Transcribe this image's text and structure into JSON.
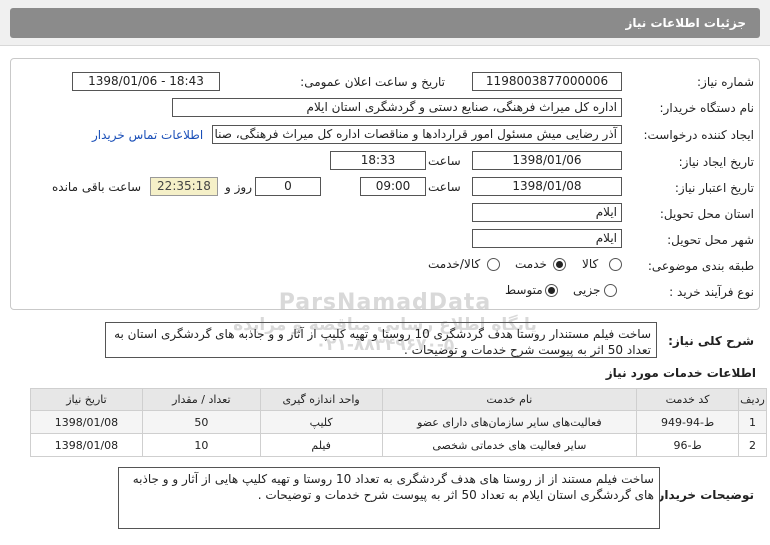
{
  "header": {
    "title": "جزئیات اطلاعات نیاز"
  },
  "form": {
    "need_number": {
      "label": "شماره نیاز:",
      "value": "1198003877000006"
    },
    "announce": {
      "label": "تاریخ و ساعت اعلان عمومی:",
      "value": "1398/01/06 - 18:43"
    },
    "buyer": {
      "label": "نام دستگاه خریدار:",
      "value": "اداره کل میراث فرهنگی، صنایع دستی و گردشگری استان ایلام"
    },
    "requester": {
      "label": "ایجاد کننده درخواست:",
      "value": "آذر رضایی میش مسئول امور قراردادها و مناقصات اداره کل میراث فرهنگی، صنا",
      "contact_link": "اطلاعات تماس خریدار"
    },
    "created": {
      "label": "تاریخ ایجاد نیاز:",
      "date": "1398/01/06",
      "time_label": "ساعت",
      "time": "18:33"
    },
    "validity": {
      "label": "تاریخ اعتبار نیاز:",
      "date": "1398/01/08",
      "time_label": "ساعت",
      "time": "09:00",
      "days": "0",
      "days_label": "روز و",
      "remaining": "22:35:18",
      "remaining_label": "ساعت باقی مانده"
    },
    "province": {
      "label": "استان محل تحویل:",
      "value": "ایلام"
    },
    "city": {
      "label": "شهر محل تحویل:",
      "value": "ایلام"
    },
    "category": {
      "label": "طبقه بندی موضوعی:",
      "options": [
        "کالا",
        "خدمت",
        "کالا/خدمت"
      ],
      "selected": "خدمت"
    },
    "process": {
      "label": "نوع فرآیند خرید :",
      "options": [
        "جزیی",
        "متوسط"
      ],
      "selected": "متوسط"
    }
  },
  "watermark": {
    "line1": "ParsNamadData",
    "line2": "پایگاه اطلاع رسانی مناقصه و مزایده",
    "line3": "۰۲۱-۸۸۳۴۹۶۷۰-۵"
  },
  "summary": {
    "label": "شرح کلی نیاز:",
    "text": "ساخت فیلم مستندار روستا هدف گردشگری 10 روستا  و  تهیه کلیپ از آثار و و جاذبه های گردشگری استان به تعداد 50 اثر به پیوست شرح خدمات و توضیحات ."
  },
  "services": {
    "title": "اطلاعات خدمات مورد نیاز",
    "columns": [
      "ردیف",
      "کد خدمت",
      "نام خدمت",
      "واحد اندازه گیری",
      "تعداد / مقدار",
      "تاریخ نیاز"
    ],
    "rows": [
      [
        "1",
        "ط-94-949",
        "فعالیت‌های سایر سازمان‌های دارای عضو",
        "کلیپ",
        "50",
        "1398/01/08"
      ],
      [
        "2",
        "ط-96",
        "سایر فعالیت های خدماتی شخصی",
        "فیلم",
        "10",
        "1398/01/08"
      ]
    ]
  },
  "buyer_notes": {
    "label": "توضیحات خریدار:",
    "text": "ساخت فیلم مستند از از روستا های هدف گردشگری به تعداد 10 روستا  و تهیه کلیپ هایی از آثار و و جاذبه های گردشگری استان ایلام به تعداد 50 اثر به پیوست شرح خدمات و توضیحات ."
  },
  "colors": {
    "header_bar": "#8b8b8b",
    "link": "#1a4fb8",
    "remaining_bg": "#f5f0c8"
  }
}
